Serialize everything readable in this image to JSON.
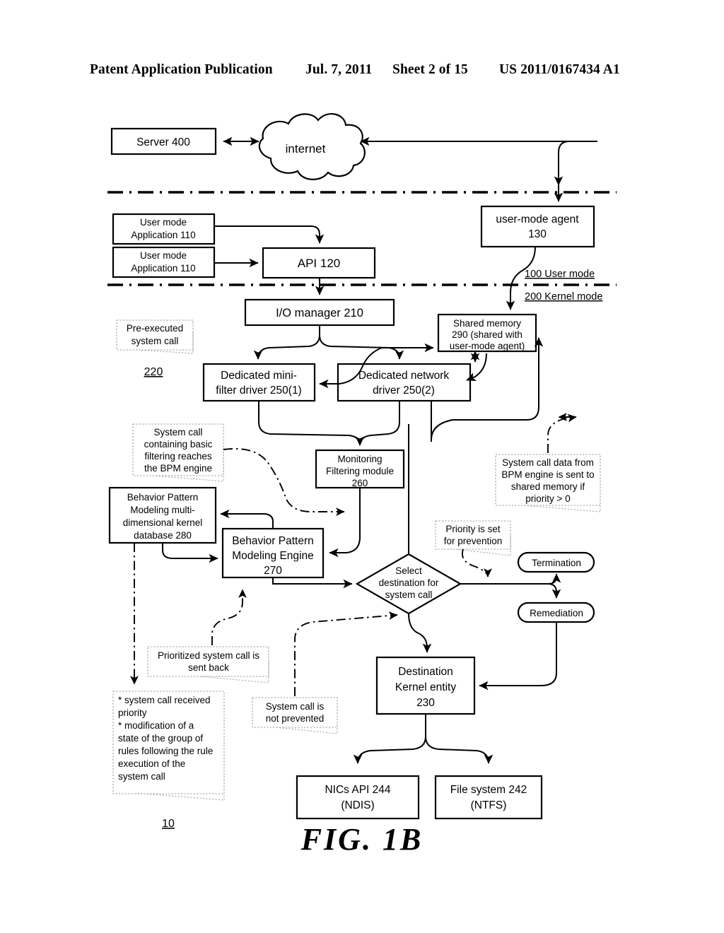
{
  "header": {
    "publication": "Patent Application Publication",
    "date": "Jul. 7, 2011",
    "sheet": "Sheet 2 of 15",
    "number": "US 2011/0167434 A1"
  },
  "figure": {
    "caption": "FIG. 1B",
    "ref_number": "10"
  },
  "mode_labels": {
    "user": "100 User mode",
    "kernel": "200 Kernel mode"
  },
  "nodes": {
    "server": {
      "line1": "Server 400"
    },
    "internet": {
      "line1": "internet"
    },
    "user_app_1": {
      "line1": "User mode",
      "line2": "Application 110"
    },
    "user_app_2": {
      "line1": "User mode",
      "line2": "Application 110"
    },
    "api": {
      "line1": "API 120"
    },
    "user_mode_agent": {
      "line1": "user-mode agent",
      "line2": "130"
    },
    "io_manager": {
      "line1": "I/O manager 210"
    },
    "shared_memory": {
      "line1": "Shared memory",
      "line2": "290 (shared with",
      "line3": "user-mode agent)"
    },
    "mini_filter_driver": {
      "line1": "Dedicated mini-",
      "line2": "filter driver 250(1)"
    },
    "network_driver": {
      "line1": "Dedicated network",
      "line2": "driver 250(2)"
    },
    "monitoring_module": {
      "line1": "Monitoring",
      "line2": "Filtering module",
      "line3": "260"
    },
    "bpm_database": {
      "line1": "Behavior Pattern",
      "line2": "Modeling multi-",
      "line3": "dimensional kernel",
      "line4": "database 280"
    },
    "bpm_engine": {
      "line1": "Behavior Pattern",
      "line2": "Modeling Engine",
      "line3": "270"
    },
    "decision": {
      "line1": "Select",
      "line2": "destination for",
      "line3": "system call"
    },
    "termination": {
      "line1": "Termination"
    },
    "remediation": {
      "line1": "Remediation"
    },
    "destination_kernel_entity": {
      "line1": "Destination",
      "line2": "Kernel entity",
      "line3": "230"
    },
    "nics_api": {
      "line1": "NICs API 244",
      "line2": "(NDIS)"
    },
    "file_system": {
      "line1": "File system 242",
      "line2": "(NTFS)"
    }
  },
  "annotations": {
    "pre_executed": {
      "line1": "Pre-executed",
      "line2": "system call",
      "ref": "220"
    },
    "basic_filtering": {
      "line1": "System call",
      "line2": "containing basic",
      "line3": "filtering reaches",
      "line4": "the BPM engine"
    },
    "bpm_to_shared": {
      "line1": "System call data from",
      "line2": "BPM engine is sent to",
      "line3": "shared memory if",
      "line4": "priority > 0"
    },
    "priority_prevention": {
      "line1": "Priority is set",
      "line2": "for prevention"
    },
    "prioritized_back": {
      "line1": "Prioritized system call is",
      "line2": "sent back"
    },
    "not_prevented": {
      "line1": "System call is",
      "line2": "not prevented"
    },
    "received_priority": {
      "line1": "* system call received",
      "line2": "priority",
      "line3": "* modification of a",
      "line4": "state of the group of",
      "line5": "rules following the rule",
      "line6": "execution of the",
      "line7": "system call"
    }
  },
  "colors": {
    "stroke": "#000000",
    "background": "#ffffff",
    "callout_stroke": "#9a9a9a"
  }
}
